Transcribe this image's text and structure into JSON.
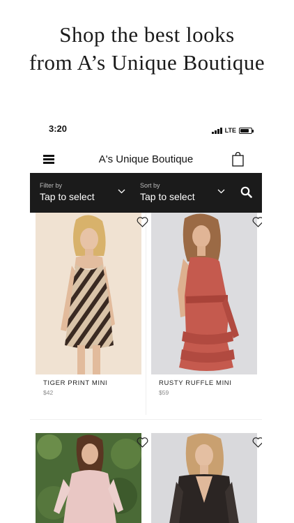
{
  "promo": {
    "line1": "Shop the best looks",
    "line2": "from A’s Unique Boutique"
  },
  "status": {
    "time": "3:20",
    "network": "LTE"
  },
  "header": {
    "title": "A's Unique Boutique"
  },
  "filter": {
    "label": "Filter by",
    "value": "Tap to select"
  },
  "sort": {
    "label": "Sort by",
    "value": "Tap to select"
  },
  "products": [
    {
      "name": "TIGER PRINT MINI",
      "price": "$42"
    },
    {
      "name": "RUSTY RUFFLE MINI",
      "price": "$59"
    },
    {
      "name": "",
      "price": ""
    },
    {
      "name": "",
      "price": ""
    }
  ],
  "colors": {
    "filterbar_bg": "#1b1b1b",
    "text": "#111111",
    "price": "#888888"
  },
  "icons": [
    "menu-icon",
    "bag-icon",
    "chevron-down-icon",
    "search-icon",
    "heart-icon"
  ]
}
